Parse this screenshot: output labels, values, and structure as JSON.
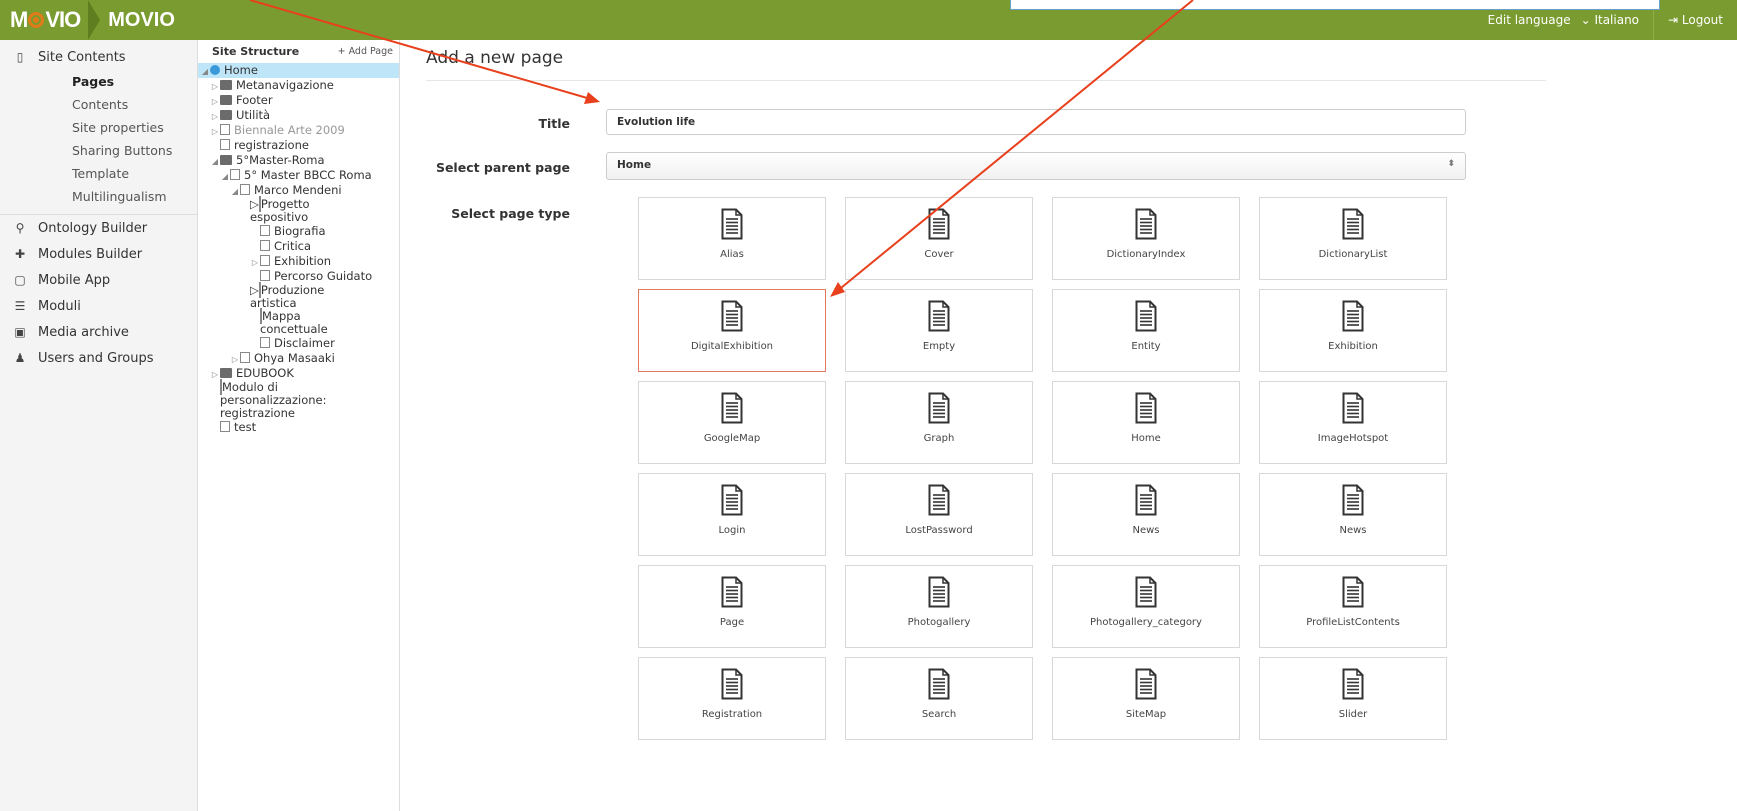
{
  "header": {
    "logo_text": "MOVIO",
    "app_name": "MOVIO",
    "edit_language_label": "Edit language",
    "language_value": "Italiano",
    "logout_label": "Logout",
    "bar_color": "#7a9b2f"
  },
  "leftnav": {
    "sections": [
      {
        "label": "Site Contents",
        "icon": "document-icon"
      },
      {
        "label": "Ontology Builder",
        "icon": "hierarchy-icon"
      },
      {
        "label": "Modules Builder",
        "icon": "plus-icon"
      },
      {
        "label": "Mobile App",
        "icon": "mobile-icon"
      },
      {
        "label": "Moduli",
        "icon": "list-icon"
      },
      {
        "label": "Media archive",
        "icon": "image-icon"
      },
      {
        "label": "Users and Groups",
        "icon": "user-icon"
      }
    ],
    "site_contents_items": [
      {
        "label": "Pages",
        "active": true
      },
      {
        "label": "Contents"
      },
      {
        "label": "Site properties"
      },
      {
        "label": "Sharing Buttons"
      },
      {
        "label": "Template"
      },
      {
        "label": "Multilingualism"
      }
    ]
  },
  "tree": {
    "title": "Site Structure",
    "add_page_label": "+ Add Page",
    "nodes": [
      "Home",
      "Metanavigazione",
      "Footer",
      "Utilità",
      "Biennale Arte 2009",
      "registrazione",
      "5°Master-Roma",
      "5° Master BBCC Roma",
      "Marco Mendeni",
      "Progetto",
      "espositivo",
      "Biografia",
      "Critica",
      "Exhibition",
      "Percorso Guidato",
      "Produzione",
      "artistica",
      "Mappa",
      "concettuale",
      "Disclaimer",
      "Ohya Masaaki",
      "EDUBOOK",
      "Modulo di",
      "personalizzazione:",
      "registrazione",
      "test"
    ]
  },
  "main": {
    "page_title": "Add a new page",
    "title_label": "Title",
    "title_value": "Evolution life",
    "parent_label": "Select parent page",
    "parent_value": "Home",
    "type_label": "Select page type",
    "page_types": [
      "Alias",
      "Cover",
      "DictionaryIndex",
      "DictionaryList",
      "DigitalExhibition",
      "Empty",
      "Entity",
      "Exhibition",
      "GoogleMap",
      "Graph",
      "Home",
      "ImageHotspot",
      "Login",
      "LostPassword",
      "News",
      "News",
      "Page",
      "Photogallery",
      "Photogallery_category",
      "ProfileListContents",
      "Registration",
      "Search",
      "SiteMap",
      "Slider"
    ],
    "selected_type": "DigitalExhibition",
    "highlight_color": "#e07a5f",
    "arrow_color": "#e8401c"
  }
}
